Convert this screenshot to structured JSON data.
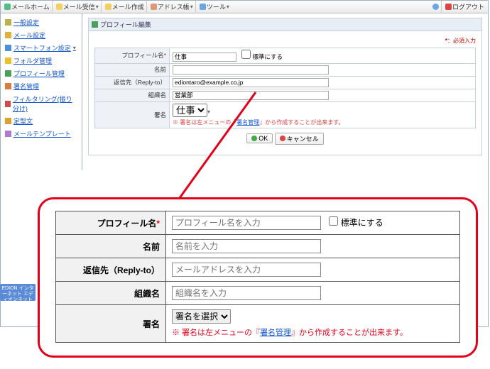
{
  "toolbar": {
    "home": "メールホーム",
    "check": "メール受信",
    "compose": "メール作成",
    "address": "アドレス帳",
    "tools": "ツール",
    "logout": "ログアウト"
  },
  "sidebar": {
    "items": [
      "一般設定",
      "メール設定",
      "スマートフォン設定",
      "フォルダ管理",
      "プロフィール管理",
      "署名管理",
      "フィルタリング(振り分け)",
      "定型文",
      "メールテンプレート"
    ]
  },
  "panel": {
    "title": "プロフィール編集",
    "required_note": "：必須入力",
    "rows": {
      "profile_name_label": "プロフィール名",
      "profile_name_value": "仕事",
      "default_label": "標準にする",
      "name_label": "名前",
      "name_value": "",
      "reply_label": "返信先（Reply-to）",
      "reply_value": "ediontaro@example.co.jp",
      "org_label": "組織名",
      "org_value": "営業部",
      "sign_label": "署名",
      "sign_value": "仕事"
    },
    "hint_prefix": "※ 署名は左メニューの『",
    "hint_link": "署名管理",
    "hint_suffix": "』から作成することが出来ます。",
    "ok": "OK",
    "cancel": "キャンセル"
  },
  "zoom": {
    "profile_name_label": "プロフィール名",
    "profile_name_placeholder": "プロフィール名を入力",
    "default_label": "標準にする",
    "name_label": "名前",
    "name_placeholder": "名前を入力",
    "reply_label": "返信先（Reply-to）",
    "reply_placeholder": "メールアドレスを入力",
    "org_label": "組織名",
    "org_placeholder": "組織名を入力",
    "sign_label": "署名",
    "sign_select": "署名を選択",
    "note_prefix": "※ 署名は左メニューの『",
    "note_link": "署名管理",
    "note_suffix": "』から作成することが出来ます。"
  },
  "footer_brand": "EDION インターネット エディオンネット"
}
